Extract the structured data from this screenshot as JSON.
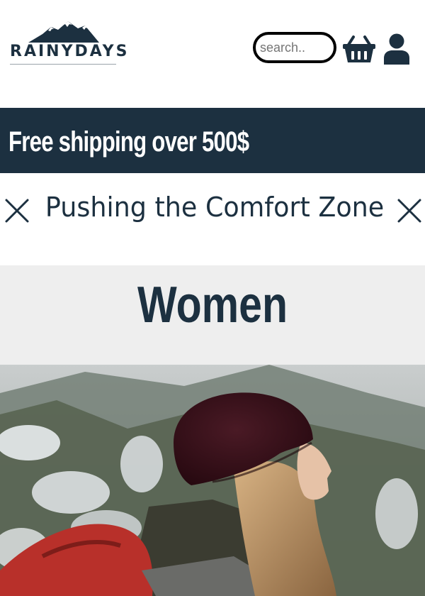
{
  "header": {
    "logo_text": "RAINYDAYS",
    "search_placeholder": "search..",
    "icons": [
      "mountain-logo-icon",
      "basket-icon",
      "user-icon"
    ]
  },
  "banner": {
    "text": "Free shipping over 500$"
  },
  "tagline": {
    "text": "Pushing the Comfort Zone",
    "icons": [
      "close-icon",
      "close-icon"
    ]
  },
  "category": {
    "title": "Women"
  },
  "colors": {
    "brand_dark": "#1c3040",
    "category_bg": "#eeeeee",
    "search_border": "#000000"
  }
}
